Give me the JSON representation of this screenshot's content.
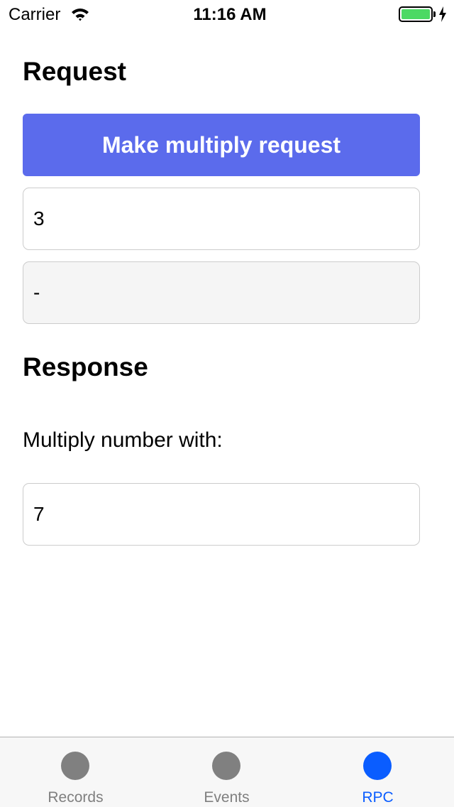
{
  "status_bar": {
    "carrier": "Carrier",
    "time": "11:16 AM",
    "icons": [
      "wifi-icon",
      "battery-icon",
      "charging-bolt-icon"
    ],
    "battery_color": "#4cd964",
    "battery_level": 1.0
  },
  "request": {
    "heading": "Request",
    "button_label": "Make multiply request",
    "button_color": "#5b6bec",
    "input_value": "3",
    "result_value": "-"
  },
  "response": {
    "heading": "Response",
    "label": "Multiply number with:",
    "multiplier_value": "7"
  },
  "tab_bar": {
    "active_color": "#0a5dff",
    "tabs": [
      {
        "label": "Records",
        "icon": "circle-icon",
        "active": false
      },
      {
        "label": "Events",
        "icon": "circle-icon",
        "active": false
      },
      {
        "label": "RPC",
        "icon": "circle-icon",
        "active": true
      }
    ]
  }
}
